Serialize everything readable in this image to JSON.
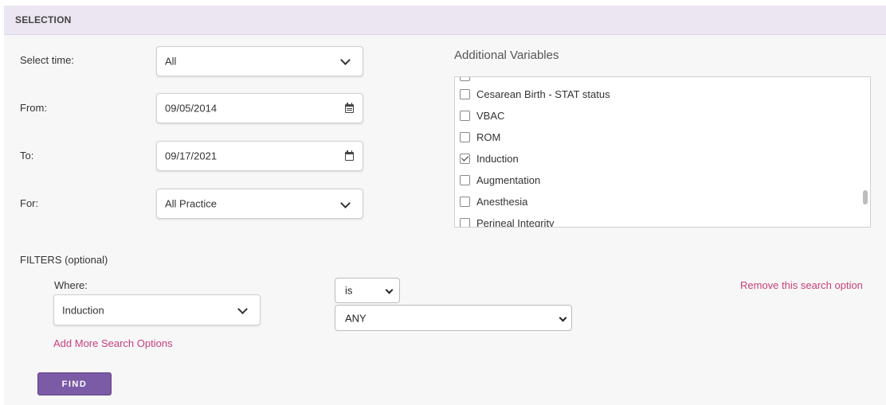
{
  "panel": {
    "title": "SELECTION"
  },
  "form": {
    "select_time": {
      "label": "Select time:",
      "value": "All"
    },
    "from": {
      "label": "From:",
      "value": "09/05/2014"
    },
    "to": {
      "label": "To:",
      "value": "09/17/2021"
    },
    "for": {
      "label": "For:",
      "value": "All Practice"
    }
  },
  "additional_variables": {
    "title": "Additional Variables",
    "items": [
      {
        "label": "",
        "checked": false
      },
      {
        "label": "Cesarean Birth - STAT status",
        "checked": false
      },
      {
        "label": "VBAC",
        "checked": false
      },
      {
        "label": "ROM",
        "checked": false
      },
      {
        "label": "Induction",
        "checked": true
      },
      {
        "label": "Augmentation",
        "checked": false
      },
      {
        "label": "Anesthesia",
        "checked": false
      },
      {
        "label": "Perineal Integrity",
        "checked": false
      }
    ]
  },
  "filters": {
    "heading": "FILTERS (optional)",
    "where_label": "Where:",
    "field_value": "Induction",
    "operator_value": "is",
    "match_value": "ANY",
    "remove_link": "Remove this search option",
    "add_more_link": "Add More Search Options"
  },
  "actions": {
    "find_label": "FIND"
  },
  "colors": {
    "accent": "#7b5aa6",
    "link": "#c8407a",
    "header_bg": "#ebe6f2"
  }
}
